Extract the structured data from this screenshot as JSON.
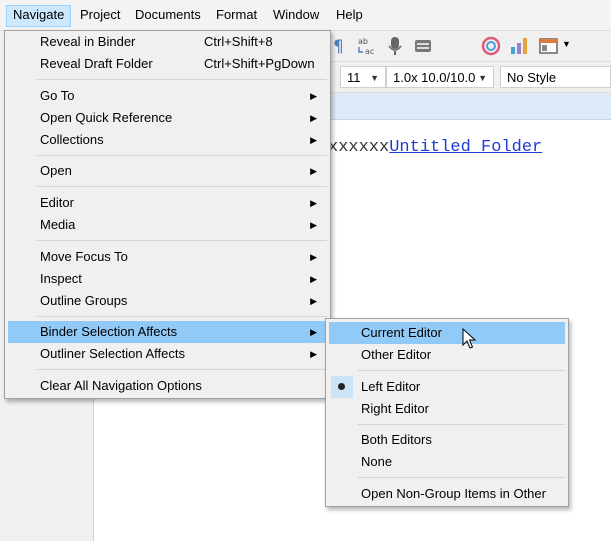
{
  "menubar": {
    "items": [
      "Navigate",
      "Project",
      "Documents",
      "Format",
      "Window",
      "Help"
    ],
    "active_index": 0
  },
  "toolbar": {
    "font_size": "11",
    "line_spacing": "1.0x 10.0/10.0",
    "style": "No Style"
  },
  "editor": {
    "text_prefix": "xxxxxx",
    "link_text": "Untitled Folder"
  },
  "navigate_menu": {
    "items": [
      {
        "label": "Reveal in Binder",
        "shortcut": "Ctrl+Shift+8"
      },
      {
        "label": "Reveal Draft Folder",
        "shortcut": "Ctrl+Shift+PgDown"
      },
      {
        "label": "Go To"
      },
      {
        "label": "Open Quick Reference"
      },
      {
        "label": "Collections"
      },
      {
        "label": "Open"
      },
      {
        "label": "Editor"
      },
      {
        "label": "Media"
      },
      {
        "label": "Move Focus To"
      },
      {
        "label": "Inspect"
      },
      {
        "label": "Outline Groups"
      },
      {
        "label": "Binder Selection Affects"
      },
      {
        "label": "Outliner Selection Affects"
      },
      {
        "label": "Clear All Navigation Options"
      }
    ]
  },
  "binder_submenu": {
    "items": [
      {
        "label": "Current Editor"
      },
      {
        "label": "Other Editor"
      },
      {
        "label": "Left Editor",
        "checked": true
      },
      {
        "label": "Right Editor"
      },
      {
        "label": "Both Editors"
      },
      {
        "label": "None"
      },
      {
        "label": "Open Non-Group Items in Other"
      }
    ]
  },
  "colors": {
    "highlight": "#91c9f7",
    "menubar_active": "#cce8ff",
    "link": "#1f3bd8",
    "header_band": "#ddeaf7"
  }
}
